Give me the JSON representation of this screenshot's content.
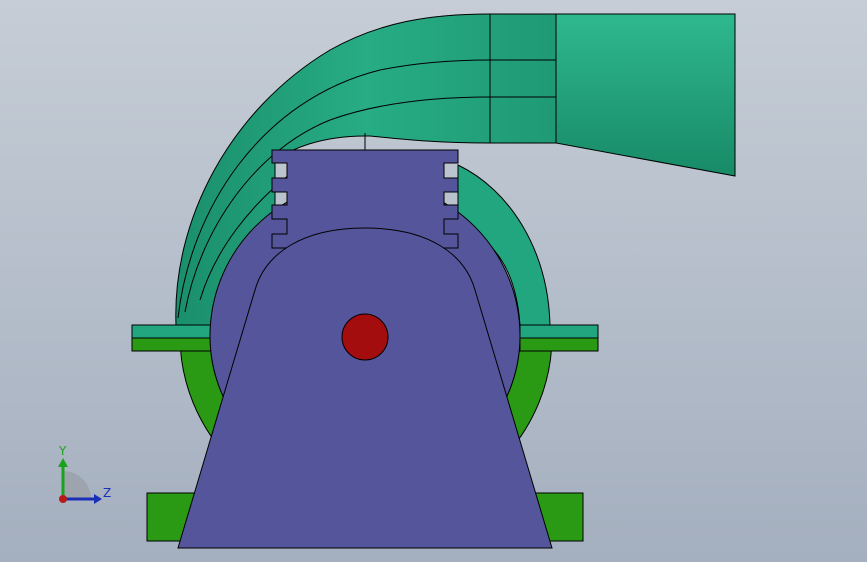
{
  "viewport": {
    "background_top": "#c6cdd6",
    "background_bottom": "#a4afbf"
  },
  "model": {
    "volute_color": "#22a67f",
    "volute_dark": "#0f6e52",
    "green_base_color": "#2a9a14",
    "bracket_color": "#55559c",
    "shaft_color": "#a30d0d",
    "outline_color": "#000000"
  },
  "triad": {
    "y_label": "Y",
    "z_label": "Z",
    "y_color": "#1aa31a",
    "z_color": "#1a2fb8",
    "x_color": "#b81a1a"
  }
}
